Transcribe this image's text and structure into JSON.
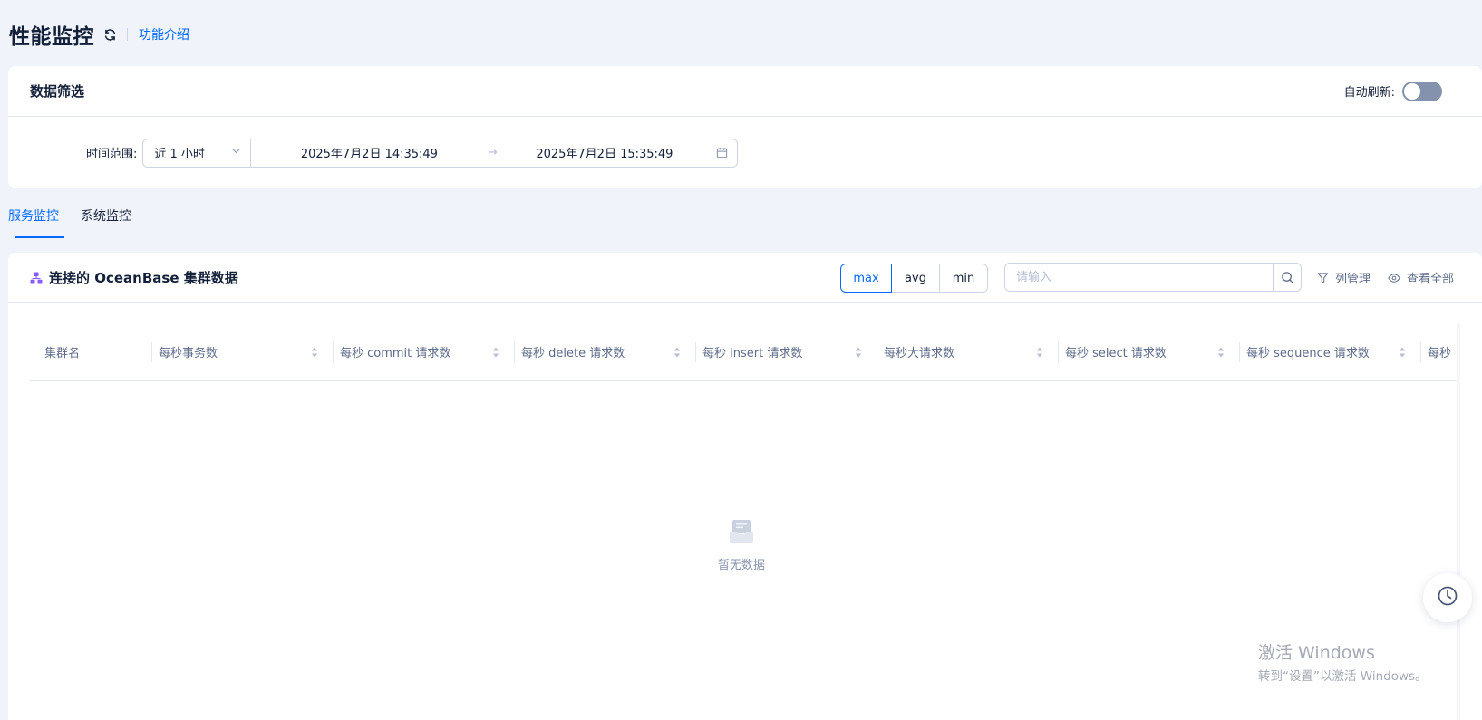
{
  "header": {
    "title": "性能监控",
    "intro_link": "功能介绍"
  },
  "filter": {
    "title": "数据筛选",
    "auto_refresh_label": "自动刷新:",
    "auto_refresh_on": false,
    "time_range_label": "时间范围:",
    "range_preset": "近 1 小时",
    "start": "2025年7月2日 14:35:49",
    "arrow": "→",
    "end": "2025年7月2日 15:35:49"
  },
  "tabs": [
    {
      "label": "服务监控",
      "active": true
    },
    {
      "label": "系统监控",
      "active": false
    }
  ],
  "section": {
    "title": "连接的 OceanBase 集群数据",
    "stats": [
      "max",
      "avg",
      "min"
    ],
    "active_stat": "max",
    "search_placeholder": "请输入",
    "column_manage": "列管理",
    "view_all": "查看全部"
  },
  "table": {
    "columns": [
      "集群名",
      "每秒事务数",
      "每秒 commit 请求数",
      "每秒 delete 请求数",
      "每秒 insert 请求数",
      "每秒大请求数",
      "每秒 select 请求数",
      "每秒 sequence 请求数",
      "每秒"
    ],
    "empty_text": "暂无数据"
  },
  "watermark": {
    "title": "激活 Windows",
    "subtitle": "转到“设置”以激活 Windows。"
  },
  "colors": {
    "accent": "#006aff",
    "text": "#132039",
    "muted": "#5c6b8a",
    "page_bg": "#f0f3fa"
  }
}
